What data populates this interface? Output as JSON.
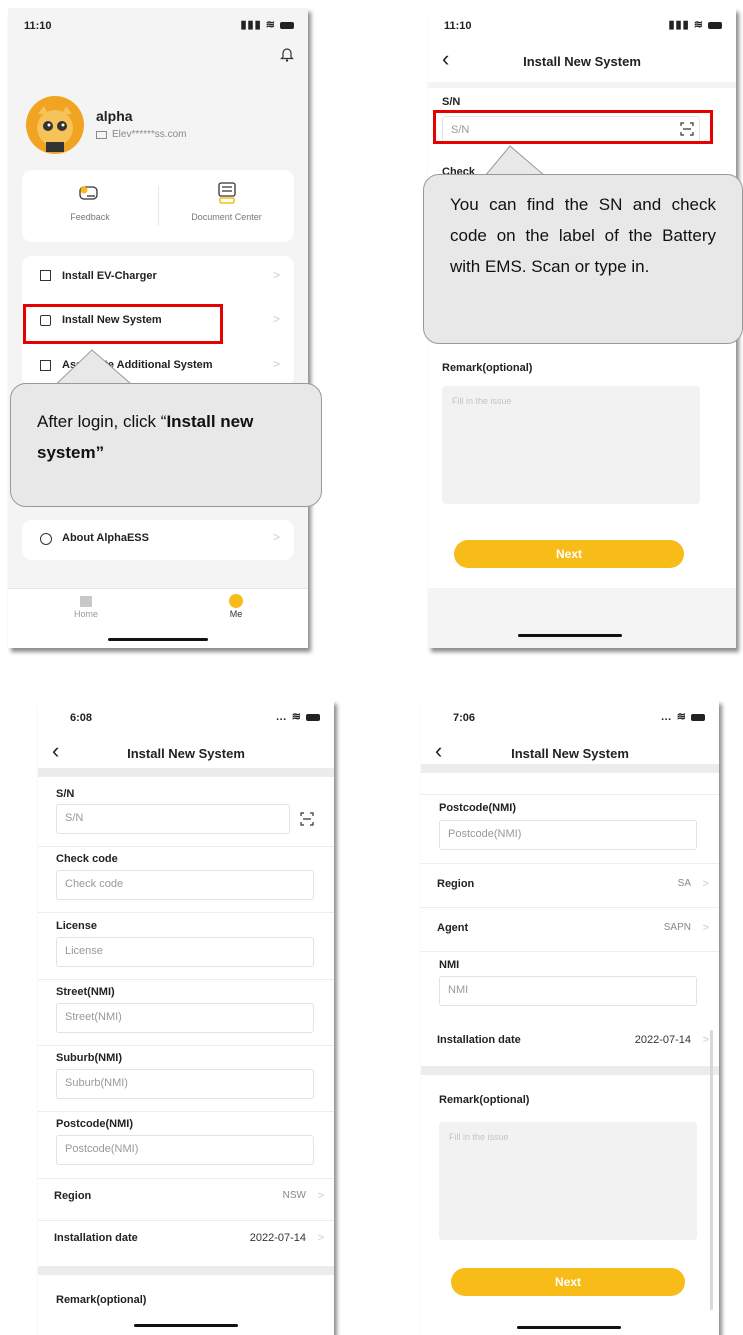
{
  "p1": {
    "time": "11:10",
    "user": {
      "name": "alpha",
      "email": "Elev******ss.com"
    },
    "quick": [
      "Feedback",
      "Document Center"
    ],
    "menu": [
      "Install EV-Charger",
      "Install New System",
      "Associate Additional System",
      "About AlphaESS"
    ],
    "tabs": [
      "Home",
      "Me"
    ],
    "callout_a": "After login, click “",
    "callout_b": "Install new system”"
  },
  "p2": {
    "time": "11:10",
    "title": "Install New System",
    "sn_label": "S/N",
    "sn_placeholder": "S/N",
    "check_label": "Check",
    "callout": "You can find the SN and check code on the label of the Battery with EMS. Scan or type in.",
    "remark_label": "Remark(optional)",
    "remark_placeholder": "Fill in the issue",
    "next": "Next"
  },
  "p3": {
    "time": "6:08",
    "title": "Install New System",
    "fields": [
      {
        "label": "S/N",
        "placeholder": "S/N"
      },
      {
        "label": "Check code",
        "placeholder": "Check code"
      },
      {
        "label": "License",
        "placeholder": "License"
      },
      {
        "label": "Street(NMI)",
        "placeholder": "Street(NMI)"
      },
      {
        "label": "Suburb(NMI)",
        "placeholder": "Suburb(NMI)"
      },
      {
        "label": "Postcode(NMI)",
        "placeholder": "Postcode(NMI)"
      }
    ],
    "region_label": "Region",
    "region_value": "NSW",
    "date_label": "Installation date",
    "date_value": "2022-07-14",
    "remark_label": "Remark(optional)"
  },
  "p4": {
    "time": "7:06",
    "title": "Install New System",
    "postcode_label": "Postcode(NMI)",
    "postcode_placeholder": "Postcode(NMI)",
    "region_label": "Region",
    "region_value": "SA",
    "agent_label": "Agent",
    "agent_value": "SAPN",
    "nmi_label": "NMI",
    "nmi_placeholder": "NMI",
    "date_label": "Installation date",
    "date_value": "2022-07-14",
    "remark_label": "Remark(optional)",
    "remark_placeholder": "Fill in the issue",
    "next": "Next"
  },
  "colors": {
    "accent": "#f8bc19",
    "highlight": "#e60000",
    "callout_bg": "#e8e8e8"
  }
}
